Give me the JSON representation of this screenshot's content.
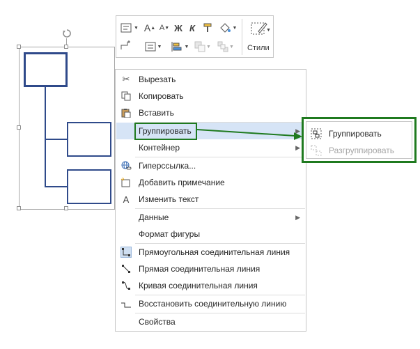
{
  "toolbar": {
    "row1": [
      "A",
      "A",
      "Ж",
      "К"
    ],
    "styles_label": "Стили"
  },
  "menu": {
    "items": [
      {
        "label": "Вырезать",
        "icon": "scissors-icon"
      },
      {
        "label": "Копировать",
        "icon": "copy-icon"
      },
      {
        "label": "Вставить",
        "icon": "paste-icon"
      },
      {
        "label": "Группировать",
        "has_submenu": true,
        "highlighted": true
      },
      {
        "label": "Контейнер",
        "has_submenu": true
      },
      {
        "label": "Гиперссылка...",
        "icon": "link-icon"
      },
      {
        "label": "Добавить примечание",
        "icon": "comment-icon"
      },
      {
        "label": "Изменить текст",
        "icon": "text-icon",
        "icon_glyph": "A"
      },
      {
        "label": "Данные",
        "has_submenu": true
      },
      {
        "label": "Формат фигуры"
      },
      {
        "label": "Прямоугольная соединительная линия",
        "icon": "right-angle-connector-icon"
      },
      {
        "label": "Прямая соединительная линия",
        "icon": "straight-connector-icon"
      },
      {
        "label": "Кривая соединительная линия",
        "icon": "curved-connector-icon"
      },
      {
        "label": "Восстановить соединительную линию",
        "icon": "reset-connector-icon"
      },
      {
        "label": "Свойства"
      }
    ]
  },
  "submenu": {
    "items": [
      {
        "label": "Группировать",
        "enabled": true
      },
      {
        "label": "Разгруппировать",
        "enabled": false
      }
    ]
  },
  "colors": {
    "highlight": "#d6e4f6",
    "annotation_green": "#1f7a1f",
    "shape_blue": "#2f4a8a"
  }
}
